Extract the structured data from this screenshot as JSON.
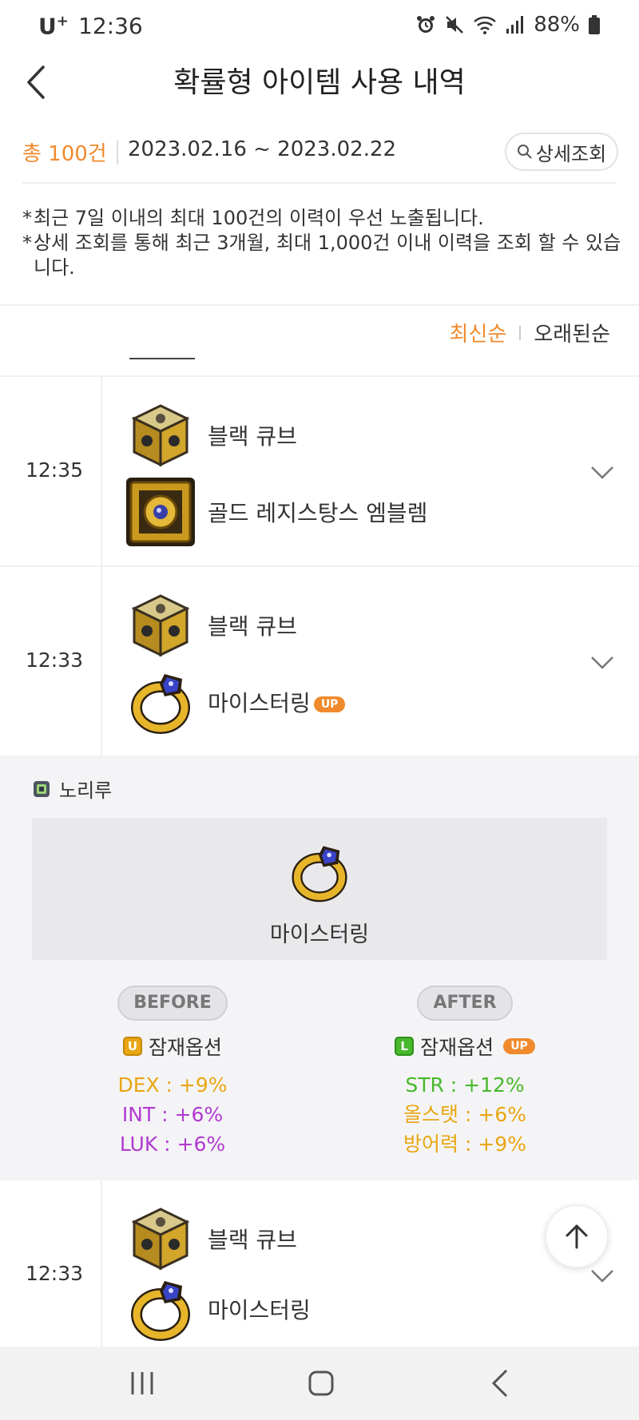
{
  "status_bar": {
    "carrier": "U",
    "carrier_sup": "+",
    "time": "12:36",
    "battery": "88%"
  },
  "header": {
    "title": "확률형 아이템 사용 내역",
    "back_icon": "chevron-left-icon"
  },
  "summary": {
    "total": "총 100건",
    "date_range": "2023.02.16 ~ 2023.02.22",
    "detail_button": "상세조회"
  },
  "notes": [
    "최근 7일 이내의 최대 100건의 이력이 우선 노출됩니다.",
    "상세 조회를 통해 최근 3개월, 최대 1,000건 이내 이력을 조회 할 수 있습니다."
  ],
  "sort": {
    "newest": "최신순",
    "oldest": "오래된순"
  },
  "entries": [
    {
      "time": "12:35",
      "cube": "블랙 큐브",
      "target": "골드 레지스탕스 엠블렘",
      "badge": ""
    },
    {
      "time": "12:33",
      "cube": "블랙 큐브",
      "target": "마이스터링",
      "badge": "UP"
    },
    {
      "time": "12:33",
      "cube": "블랙 큐브",
      "target": "마이스터링",
      "badge": ""
    }
  ],
  "detail": {
    "character": "노리루",
    "item_name": "마이스터링",
    "before": {
      "label": "BEFORE",
      "grade_letter": "U",
      "option_title": "잠재옵션",
      "options": [
        {
          "text": "DEX : +9%",
          "color": "#e9a612"
        },
        {
          "text": "INT : +6%",
          "color": "#b23ad1"
        },
        {
          "text": "LUK : +6%",
          "color": "#b23ad1"
        }
      ]
    },
    "after": {
      "label": "AFTER",
      "grade_letter": "L",
      "option_title": "잠재옵션",
      "badge": "UP",
      "options": [
        {
          "text": "STR : +12%",
          "color": "#48b82c"
        },
        {
          "text": "올스탯 : +6%",
          "color": "#e9a612"
        },
        {
          "text": "방어력 : +9%",
          "color": "#e9a612"
        }
      ]
    }
  },
  "colors": {
    "accent": "#f08a2c",
    "unique": "#e9a612",
    "legendary": "#48b82c",
    "epic": "#b23ad1"
  }
}
